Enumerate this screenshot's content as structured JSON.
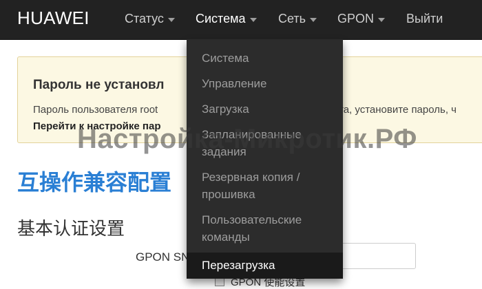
{
  "navbar": {
    "brand": "HUAWEI",
    "items": [
      {
        "label": "Статус",
        "has_caret": true
      },
      {
        "label": "Система",
        "has_caret": true
      },
      {
        "label": "Сеть",
        "has_caret": true
      },
      {
        "label": "GPON",
        "has_caret": true
      },
      {
        "label": "Выйти",
        "has_caret": false
      }
    ]
  },
  "alert": {
    "title": "Пароль не установл",
    "text": "Пароль пользователя root",
    "text_right": "та, установите пароль, ч",
    "link": "Перейти к настройке пар"
  },
  "page": {
    "title": "互操作兼容配置",
    "section": "基本认证设置",
    "field_label": "GPON SN",
    "field_value": "",
    "checkbox_label": "GPON 使能设置"
  },
  "dropdown": {
    "items": [
      {
        "label": "Система",
        "lines": [
          "Система"
        ]
      },
      {
        "label": "Управление",
        "lines": [
          "Управление"
        ]
      },
      {
        "label": "Загрузка",
        "lines": [
          "Загрузка"
        ]
      },
      {
        "label": "Запланированные задания",
        "lines": [
          "Запланированные",
          "задания"
        ]
      },
      {
        "label": "Резервная копия / прошивка",
        "lines": [
          "Резервная копия /",
          "прошивка"
        ]
      },
      {
        "label": "Пользовательские команды",
        "lines": [
          "Пользовательские",
          "команды"
        ]
      },
      {
        "label": "Перезагрузка",
        "lines": [
          "Перезагрузка"
        ],
        "active": true
      }
    ]
  },
  "watermark": "Настройка-Микротик.РФ",
  "colors": {
    "navbar_bg": "#222222",
    "alert_bg": "#fcf8e3",
    "title_blue": "#2a7fd4",
    "dropdown_bg": "#2c2c2c"
  }
}
